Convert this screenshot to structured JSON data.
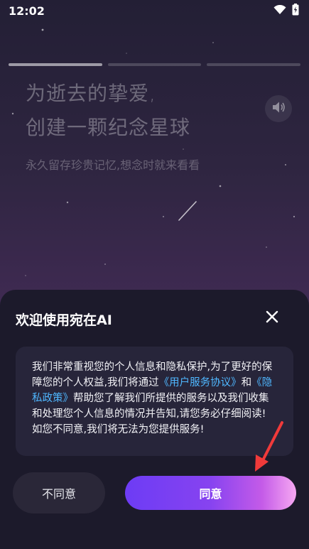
{
  "status_bar": {
    "time": "12:02"
  },
  "hero": {
    "headline_line1": "为逝去的挚爱,",
    "headline_line2": "创建一颗纪念星球",
    "subline": "永久留存珍贵记忆,想念时就来看看"
  },
  "dialog": {
    "title": "欢迎使用宛在AI",
    "body_part1": "我们非常重视您的个人信息和隐私保护,为了更好的保障您的个人权益,我们将通过",
    "link_user_agreement": "《用户服务协议》",
    "body_and": "和",
    "link_privacy_policy": "《隐私政策》",
    "body_part2": "帮助您了解我们所提供的服务以及我们收集和处理您个人信息的情况并告知,请您务必仔细阅读!",
    "body_line_last": "如您不同意,我们将无法为您提供服务!",
    "disagree_label": "不同意",
    "agree_label": "同意"
  },
  "icons": {
    "wifi": "wifi-icon",
    "battery": "battery-charging-icon",
    "speaker": "speaker-icon",
    "close": "close-icon",
    "arrow": "red-arrow-icon"
  },
  "colors": {
    "link": "#4fb7ff",
    "sheet_bg": "#1c1a2b",
    "agree_gradient_start": "#6d3cf5",
    "agree_gradient_end": "#f6a8f2",
    "arrow": "#f03a3a"
  },
  "progress": {
    "segments": 3,
    "active_index": 0
  }
}
